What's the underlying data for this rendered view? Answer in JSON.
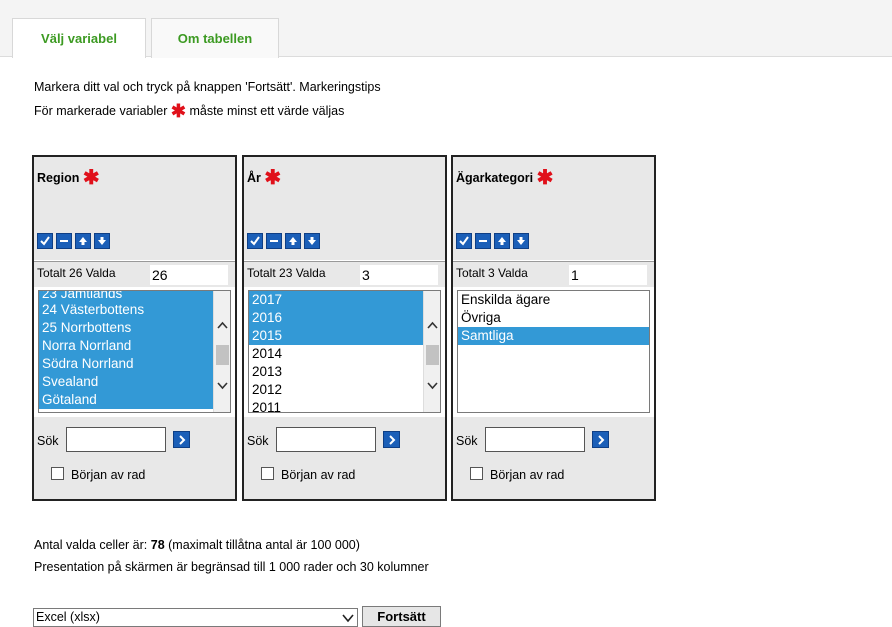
{
  "tabs": [
    {
      "label": "Välj variabel",
      "active": true
    },
    {
      "label": "Om tabellen",
      "active": false
    }
  ],
  "instructions": {
    "line1": "Markera ditt val och tryck på knappen 'Fortsätt'. Markeringstips",
    "line2_prefix": "För markerade variabler",
    "line2_suffix": "måste minst ett värde väljas",
    "star": "✱"
  },
  "panels": [
    {
      "title": "Region",
      "total_label": "Totalt 26 Valda",
      "selected_count": "26",
      "options": [
        {
          "label": "23 Jämtlands",
          "selected": true
        },
        {
          "label": "24 Västerbottens",
          "selected": true
        },
        {
          "label": "25 Norrbottens",
          "selected": true
        },
        {
          "label": "Norra Norrland",
          "selected": true
        },
        {
          "label": "Södra Norrland",
          "selected": true
        },
        {
          "label": "Svealand",
          "selected": true
        },
        {
          "label": "Götaland",
          "selected": true
        }
      ],
      "search_label": "Sök",
      "begin_row_label": "Början av rad"
    },
    {
      "title": "År",
      "total_label": "Totalt 23 Valda",
      "selected_count": "3",
      "options": [
        {
          "label": "2017",
          "selected": true
        },
        {
          "label": "2016",
          "selected": true
        },
        {
          "label": "2015",
          "selected": true
        },
        {
          "label": "2014",
          "selected": false
        },
        {
          "label": "2013",
          "selected": false
        },
        {
          "label": "2012",
          "selected": false
        },
        {
          "label": "2011",
          "selected": false
        }
      ],
      "search_label": "Sök",
      "begin_row_label": "Början av rad"
    },
    {
      "title": "Ägarkategori",
      "total_label": "Totalt 3 Valda",
      "selected_count": "1",
      "options": [
        {
          "label": "Enskilda ägare",
          "selected": false
        },
        {
          "label": "Övriga",
          "selected": false
        },
        {
          "label": "Samtliga",
          "selected": true
        }
      ],
      "search_label": "Sök",
      "begin_row_label": "Början av rad"
    }
  ],
  "cells_info": {
    "prefix": "Antal valda celler är:",
    "count": "78",
    "suffix": "(maximalt tillåtna antal är 100 000)"
  },
  "presentation_note": "Presentation på skärmen är begränsad till 1 000 rader och 30 kolumner",
  "format_select": {
    "value": "Excel (xlsx)"
  },
  "continue_button": "Fortsätt",
  "colors": {
    "accent": "#3c9a22",
    "selection": "#3399d6",
    "icon_blue": "#1b5fb8",
    "required": "#e0101a"
  },
  "icons": [
    "select-all-icon",
    "deselect-all-icon",
    "sort-up-icon",
    "sort-down-icon",
    "search-go-icon",
    "scroll-up-icon",
    "scroll-down-icon",
    "dropdown-chevron-icon"
  ]
}
